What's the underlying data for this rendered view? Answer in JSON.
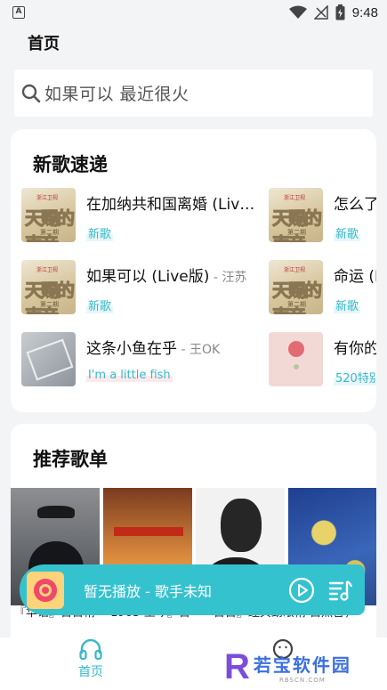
{
  "status_bar": {
    "time": "9:48",
    "notification_letter": "A"
  },
  "header": {
    "title": "首页"
  },
  "search": {
    "placeholder": "如果可以 最近很火"
  },
  "new_songs": {
    "title": "新歌速递",
    "cover_show_text": {
      "logo": "天赐的声音",
      "small": "浙江卫视",
      "episode": "第二期"
    },
    "items": [
      {
        "title": "在加纳共和国离婚 (Liv…",
        "artist": "",
        "tag": "新歌"
      },
      {
        "title": "怎么了",
        "artist": "",
        "tag": "新歌"
      },
      {
        "title": "如果可以 (Live版)",
        "artist": "汪苏",
        "tag": "新歌"
      },
      {
        "title": "命运 (L",
        "artist": "",
        "tag": "新歌"
      },
      {
        "title": "这条小鱼在乎",
        "artist": "王OK",
        "tag": "I'm a little fish"
      },
      {
        "title": "有你的",
        "artist": "",
        "tag": "520特别"
      }
    ]
  },
  "recommended": {
    "title": "推荐歌单",
    "caption": "『华语』百首精 『1963-至今』百『一百首』经典劲眼精 自然音，"
  },
  "player": {
    "title": "暂无播放 - 歌手未知"
  },
  "tabs": [
    {
      "label": "首页"
    }
  ],
  "watermark": {
    "brand": "若宝软件园",
    "small": "RBSCN.COM",
    "letter": "R"
  },
  "colors": {
    "accent": "#35c2cf",
    "tag_text": "#35b8c8",
    "background": "#f3f4f6"
  }
}
